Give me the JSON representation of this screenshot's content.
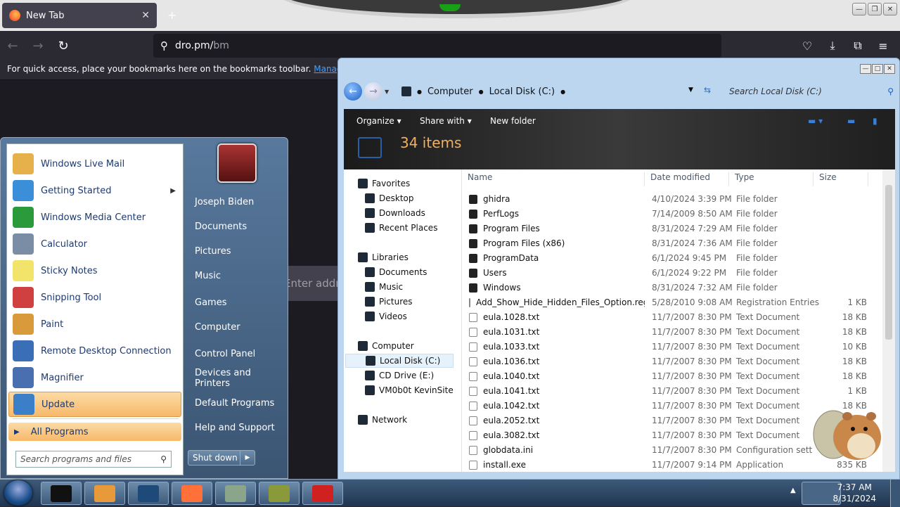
{
  "browser": {
    "tab_title": "New Tab",
    "tab_close": "✕",
    "new_tab": "+",
    "url_text": "dro.pm/",
    "url_hint": "bm",
    "bookmarks_text": "For quick access, place your bookmarks here on the bookmarks toolbar.",
    "bookmarks_link": "Manage bookmarks…",
    "search_hint": "Enter address"
  },
  "start_menu": {
    "programs": [
      {
        "label": "Windows Live Mail",
        "color": "#e6b04a"
      },
      {
        "label": "Getting Started",
        "color": "#3a8fd8"
      },
      {
        "label": "Windows Media Center",
        "color": "#2a9a3a"
      },
      {
        "label": "Calculator",
        "color": "#7a8da5"
      },
      {
        "label": "Sticky Notes",
        "color": "#f2e36b"
      },
      {
        "label": "Snipping Tool",
        "color": "#d04040"
      },
      {
        "label": "Paint",
        "color": "#d89a3a"
      },
      {
        "label": "Remote Desktop Connection",
        "color": "#3a6fb8"
      },
      {
        "label": "Magnifier",
        "color": "#4a6fb0"
      },
      {
        "label": "Update",
        "color": "#3a7fc8"
      }
    ],
    "all_programs": "All Programs",
    "search_placeholder": "Search programs and files",
    "right": [
      "Joseph Biden",
      "Documents",
      "Pictures",
      "Music",
      "Games",
      "Computer",
      "Control Panel",
      "Devices and Printers",
      "Default Programs",
      "Help and Support"
    ],
    "shutdown": "Shut down"
  },
  "explorer": {
    "crumbs": [
      "Computer",
      "Local Disk (C:)"
    ],
    "search_placeholder": "Search Local Disk (C:)",
    "toolbar": {
      "organize": "Organize",
      "share": "Share with",
      "new_folder": "New folder"
    },
    "items_count": "34 items",
    "columns": {
      "name": "Name",
      "date": "Date modified",
      "type": "Type",
      "size": "Size"
    },
    "nav": [
      {
        "label": "Favorites",
        "level": 0
      },
      {
        "label": "Desktop",
        "level": 1
      },
      {
        "label": "Downloads",
        "level": 1
      },
      {
        "label": "Recent Places",
        "level": 1
      },
      {
        "label": "Libraries",
        "level": 0
      },
      {
        "label": "Documents",
        "level": 1
      },
      {
        "label": "Music",
        "level": 1
      },
      {
        "label": "Pictures",
        "level": 1
      },
      {
        "label": "Videos",
        "level": 1
      },
      {
        "label": "Computer",
        "level": 0
      },
      {
        "label": "Local Disk (C:)",
        "level": 1
      },
      {
        "label": "CD Drive (E:)",
        "level": 1
      },
      {
        "label": "VM0b0t KevinSite",
        "level": 1
      },
      {
        "label": "Network",
        "level": 0
      }
    ],
    "files": [
      {
        "name": "ghidra",
        "date": "4/10/2024 3:39 PM",
        "type": "File folder",
        "size": ""
      },
      {
        "name": "PerfLogs",
        "date": "7/14/2009 8:50 AM",
        "type": "File folder",
        "size": ""
      },
      {
        "name": "Program Files",
        "date": "8/31/2024 7:29 AM",
        "type": "File folder",
        "size": ""
      },
      {
        "name": "Program Files (x86)",
        "date": "8/31/2024 7:36 AM",
        "type": "File folder",
        "size": ""
      },
      {
        "name": "ProgramData",
        "date": "6/1/2024 9:45 PM",
        "type": "File folder",
        "size": ""
      },
      {
        "name": "Users",
        "date": "6/1/2024 9:22 PM",
        "type": "File folder",
        "size": ""
      },
      {
        "name": "Windows",
        "date": "8/31/2024 7:32 AM",
        "type": "File folder",
        "size": ""
      },
      {
        "name": "Add_Show_Hide_Hidden_Files_Option.reg",
        "date": "5/28/2010 9:08 AM",
        "type": "Registration Entries",
        "size": "1 KB"
      },
      {
        "name": "eula.1028.txt",
        "date": "11/7/2007 8:30 PM",
        "type": "Text Document",
        "size": "18 KB"
      },
      {
        "name": "eula.1031.txt",
        "date": "11/7/2007 8:30 PM",
        "type": "Text Document",
        "size": "18 KB"
      },
      {
        "name": "eula.1033.txt",
        "date": "11/7/2007 8:30 PM",
        "type": "Text Document",
        "size": "10 KB"
      },
      {
        "name": "eula.1036.txt",
        "date": "11/7/2007 8:30 PM",
        "type": "Text Document",
        "size": "18 KB"
      },
      {
        "name": "eula.1040.txt",
        "date": "11/7/2007 8:30 PM",
        "type": "Text Document",
        "size": "18 KB"
      },
      {
        "name": "eula.1041.txt",
        "date": "11/7/2007 8:30 PM",
        "type": "Text Document",
        "size": "1 KB"
      },
      {
        "name": "eula.1042.txt",
        "date": "11/7/2007 8:30 PM",
        "type": "Text Document",
        "size": "18 KB"
      },
      {
        "name": "eula.2052.txt",
        "date": "11/7/2007 8:30 PM",
        "type": "Text Document",
        "size": ""
      },
      {
        "name": "eula.3082.txt",
        "date": "11/7/2007 8:30 PM",
        "type": "Text Document",
        "size": ""
      },
      {
        "name": "globdata.ini",
        "date": "11/7/2007 8:30 PM",
        "type": "Configuration sett",
        "size": ""
      },
      {
        "name": "install.exe",
        "date": "11/7/2007 9:14 PM",
        "type": "Application",
        "size": "835 KB"
      }
    ]
  },
  "taskbar": {
    "apps": [
      {
        "name": "cmd",
        "color": "#111111"
      },
      {
        "name": "media-player",
        "color": "#e89a3a"
      },
      {
        "name": "globe",
        "color": "#1e4a7a"
      },
      {
        "name": "firefox",
        "color": "#ff7139"
      },
      {
        "name": "notepad",
        "color": "#8aa58a"
      },
      {
        "name": "box-game",
        "color": "#8a9a3a"
      },
      {
        "name": "paint-app",
        "color": "#d02020"
      }
    ],
    "time": "7:37 AM",
    "date": "8/31/2024"
  }
}
